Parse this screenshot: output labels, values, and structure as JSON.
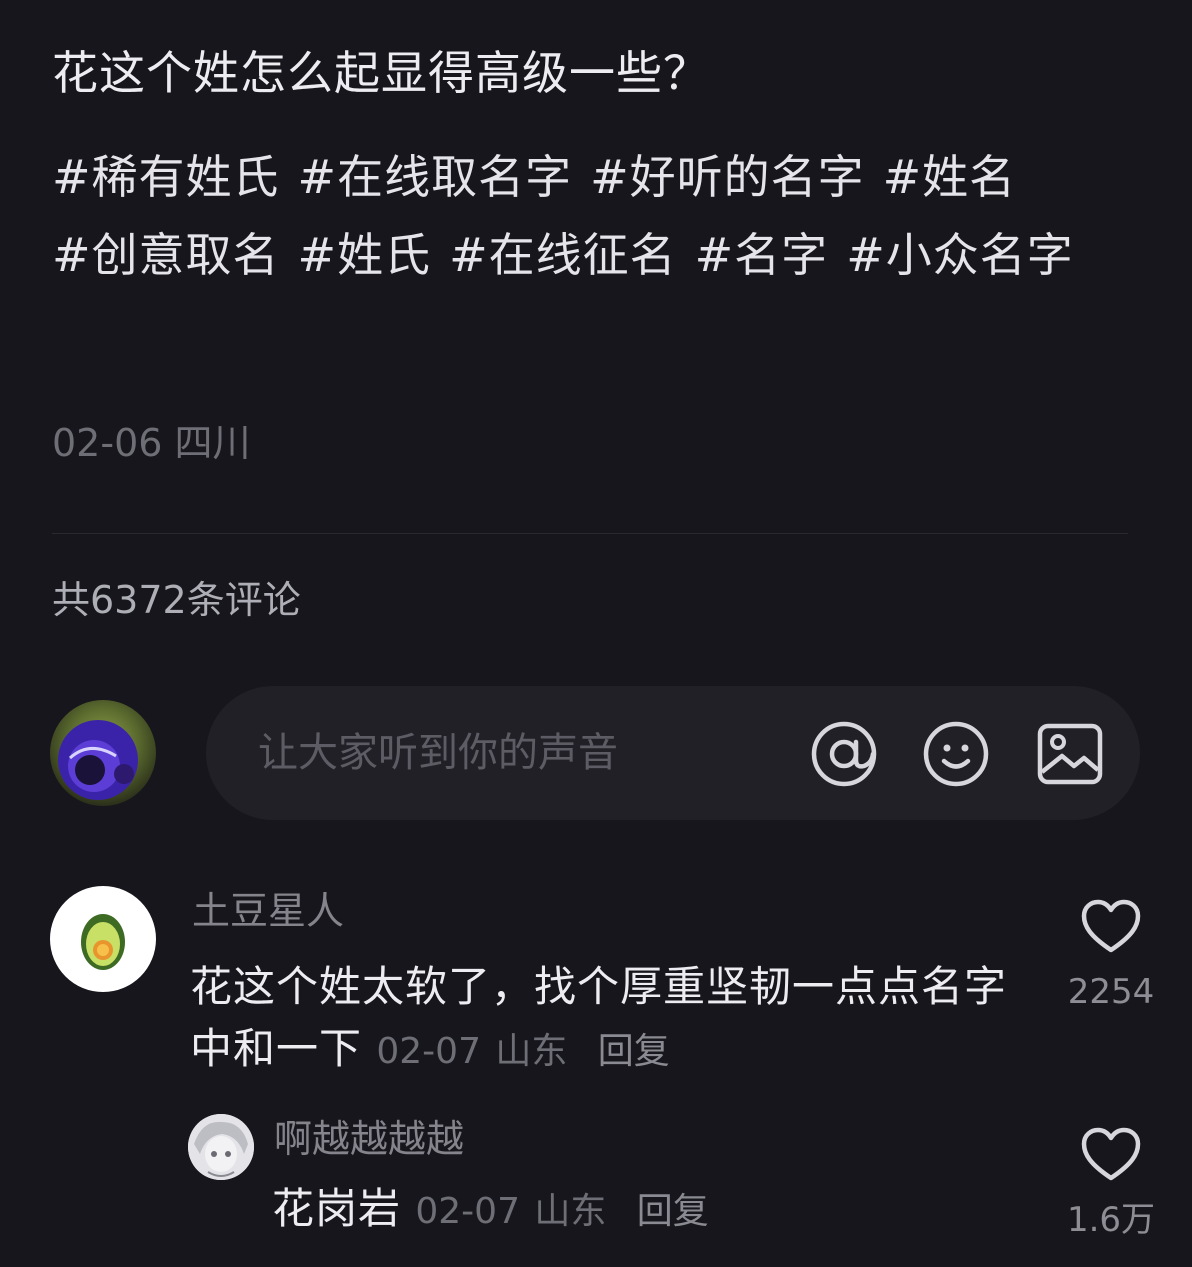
{
  "post": {
    "title": "花这个姓怎么起显得高级一些？",
    "tags": [
      "#稀有姓氏",
      "#在线取名字",
      "#好听的名字",
      "#姓名",
      "#创意取名",
      "#姓氏",
      "#在线征名",
      "#名字",
      "#小众名字"
    ],
    "date": "02-06",
    "location": "四川"
  },
  "comments_header": {
    "count_label": "共6372条评论"
  },
  "composer": {
    "placeholder": "让大家听到你的声音",
    "icons": [
      "at-icon",
      "emoji-icon",
      "image-icon"
    ]
  },
  "comments": [
    {
      "username": "土豆星人",
      "avatar": "avocado-avatar",
      "text": "花这个姓太软了，找个厚重坚韧一点点名字中和一下",
      "date": "02-07",
      "location": "山东",
      "reply_label": "回复",
      "likes": "2254"
    }
  ],
  "replies": [
    {
      "username": "啊越越越越",
      "avatar": "anime-avatar",
      "text": "花岗岩",
      "date": "02-07",
      "location": "山东",
      "reply_label": "回复",
      "likes": "1.6万"
    }
  ],
  "colors": {
    "background": "#17161c",
    "input_background": "#212027",
    "primary_text": "#ececf1",
    "secondary_text": "#6e6e76"
  }
}
